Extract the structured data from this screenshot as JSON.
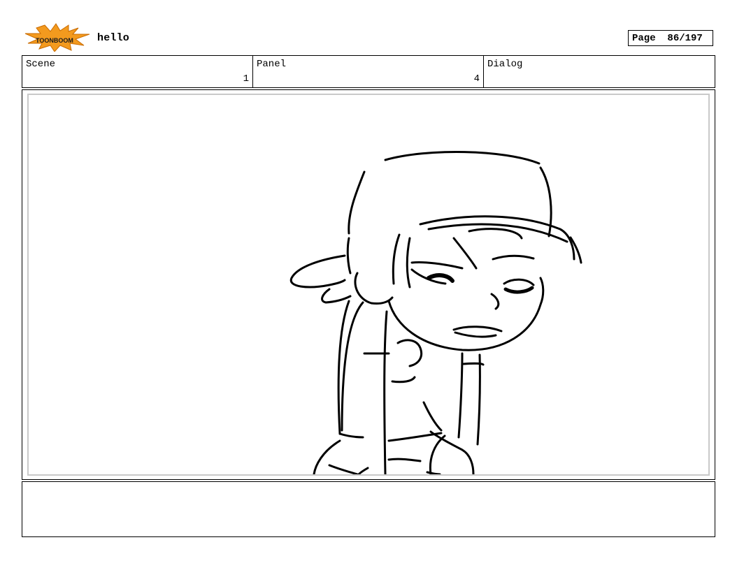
{
  "header": {
    "logo_text": "TOONBOOM",
    "project_title": "hello",
    "page_label": "Page",
    "page_number": "86/197"
  },
  "info_row": {
    "scene_label": "Scene",
    "scene_value": "1",
    "panel_label": "Panel",
    "panel_value": "4",
    "dialog_label": "Dialog",
    "dialog_value": ""
  },
  "panel": {
    "image": "storyboard-sketch-character-with-cap"
  },
  "notes": {
    "text": ""
  },
  "colors": {
    "logo_burst": "#f39a1e",
    "logo_text": "#1a1a1a",
    "frame_border": "#000000",
    "inner_border": "#c9c9c9"
  }
}
